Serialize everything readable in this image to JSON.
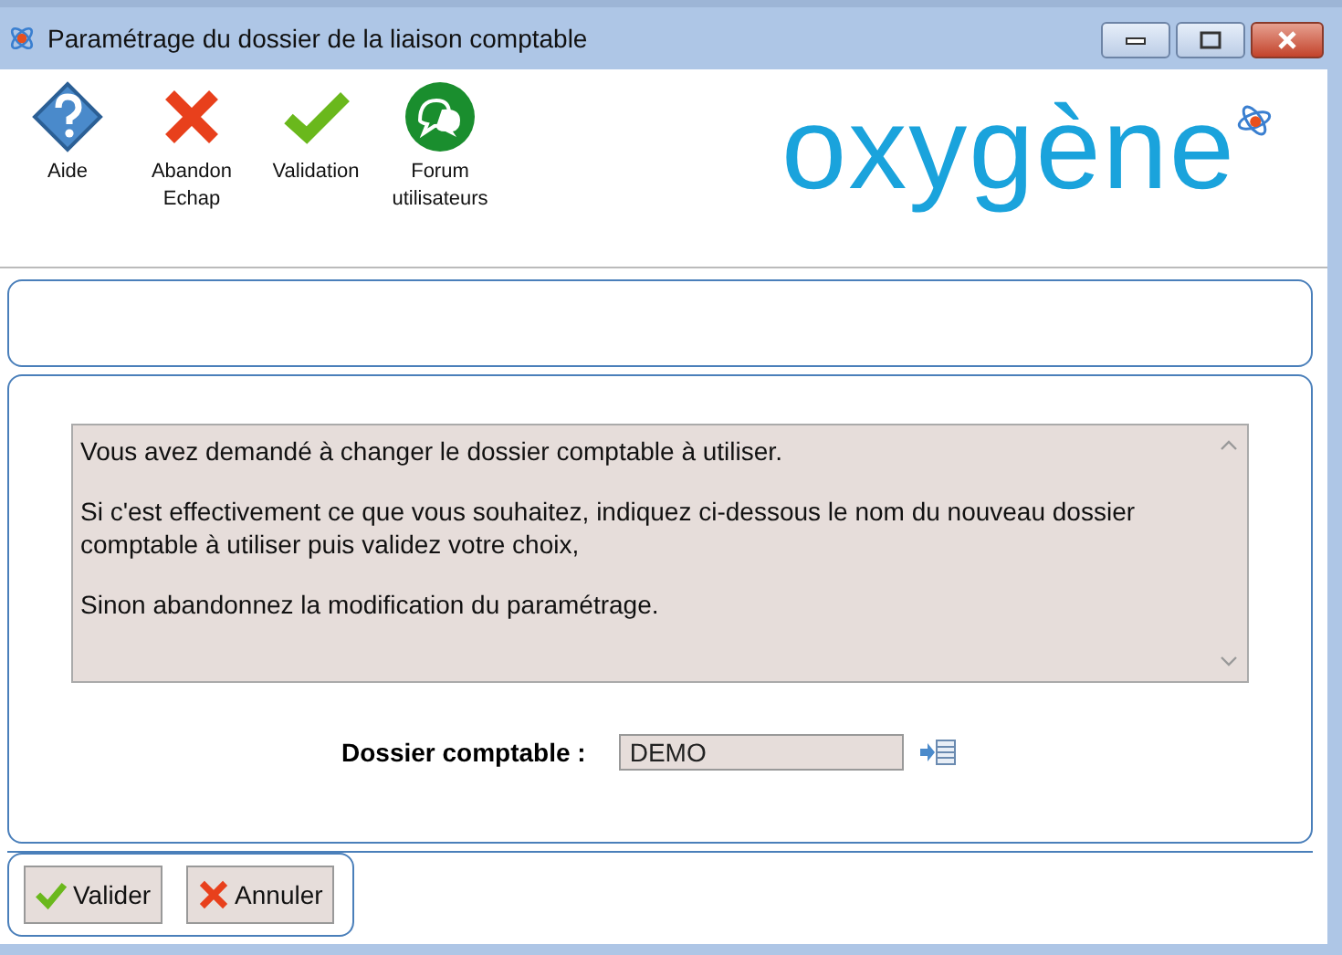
{
  "window": {
    "title": "Paramétrage du dossier de la liaison comptable"
  },
  "toolbar": [
    {
      "kind": "help",
      "label": "Aide"
    },
    {
      "kind": "cancel",
      "label": "Abandon\nEchap"
    },
    {
      "kind": "validate",
      "label": "Validation"
    },
    {
      "kind": "forum",
      "label": "Forum\nutilisateurs"
    }
  ],
  "logo": {
    "text": "oxygène"
  },
  "message": [
    "Vous avez demandé à changer le dossier comptable à utiliser.",
    "Si c'est effectivement ce que vous souhaitez, indiquez ci-dessous le nom du nouveau dossier comptable à utiliser puis validez votre choix,",
    "Sinon abandonnez la modification du paramétrage."
  ],
  "field": {
    "label": "Dossier comptable :",
    "value": "DEMO"
  },
  "buttons": [
    {
      "kind": "validate",
      "label": "Valider"
    },
    {
      "kind": "cancel",
      "label": "Annuler"
    }
  ]
}
